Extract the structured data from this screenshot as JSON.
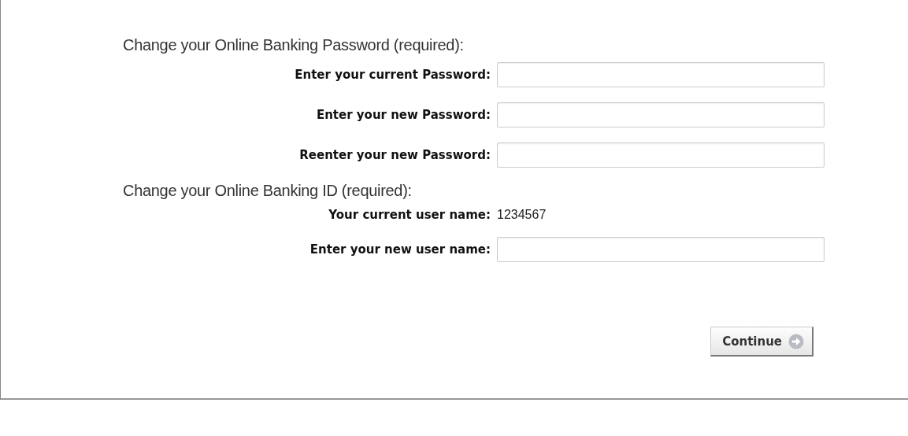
{
  "sections": [
    {
      "heading": "Change your Online Banking Password (required):",
      "rows": [
        {
          "kind": "field",
          "label": "Enter your current Password:"
        },
        {
          "kind": "field",
          "label": "Enter your new Password:"
        },
        {
          "kind": "field",
          "label": "Reenter your new Password:"
        }
      ]
    },
    {
      "heading": "Change your Online Banking ID (required):",
      "rows": [
        {
          "kind": "text",
          "label": "Your current user name:",
          "value": "1234567"
        },
        {
          "kind": "field",
          "label": "Enter your new user name:"
        }
      ]
    }
  ],
  "button": {
    "label": "Continue"
  }
}
